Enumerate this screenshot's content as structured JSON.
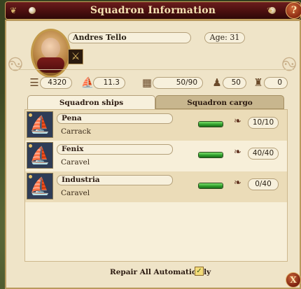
{
  "window": {
    "title": "Squadron Information",
    "help_label": "?",
    "close_label": "X"
  },
  "captain": {
    "name": "Andres Tello",
    "age": "Age: 31"
  },
  "stats": [
    {
      "icon": "gold-coins-icon",
      "value": "4320"
    },
    {
      "icon": "ship-speed-icon",
      "value": "11.3"
    },
    {
      "icon": "cargo-crate-icon",
      "value": "50/90"
    },
    {
      "icon": "sailors-icon",
      "value": "50"
    },
    {
      "icon": "soldiers-icon",
      "value": "0"
    }
  ],
  "tabs": {
    "ships": "Squadron ships",
    "cargo": "Squadron cargo"
  },
  "ships": [
    {
      "name": "Pena",
      "type": "Carrack",
      "cargo": "10/10",
      "health": 1.0
    },
    {
      "name": "Fenix",
      "type": "Caravel",
      "cargo": "40/40",
      "health": 1.0
    },
    {
      "name": "Industria",
      "type": "Caravel",
      "cargo": "0/40",
      "health": 1.0
    }
  ],
  "footer": {
    "repair_label": "Repair All Automatically",
    "repair_checked": true
  }
}
